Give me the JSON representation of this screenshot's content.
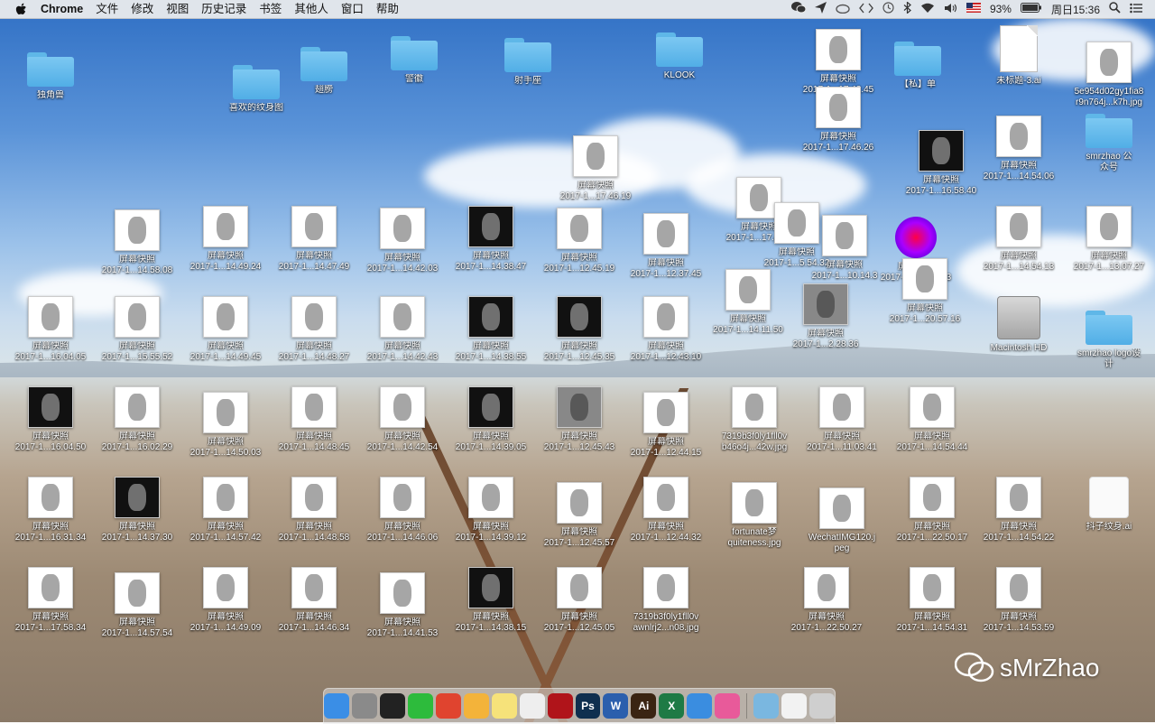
{
  "menubar": {
    "app": "Chrome",
    "menus": [
      "文件",
      "修改",
      "视图",
      "历史记录",
      "书签",
      "其他人",
      "窗口",
      "帮助"
    ],
    "battery": "93%",
    "clock": "周日15:36"
  },
  "desktop_items": [
    {
      "label": "独角兽",
      "kind": "folder"
    },
    {
      "label": "喜欢的纹身图",
      "kind": "folder"
    },
    {
      "label": "翅膀",
      "kind": "folder"
    },
    {
      "label": "警徽",
      "kind": "folder"
    },
    {
      "label": "射手座",
      "kind": "folder"
    },
    {
      "label": "KLOOK",
      "kind": "folder"
    },
    {
      "label": "屏幕快照\n2017-1...17.42.45",
      "kind": "thumb"
    },
    {
      "label": "【私】单",
      "kind": "folder"
    },
    {
      "label": "未标题-3.ai",
      "kind": "doc"
    },
    {
      "label": "5e954d02gy1fia8\nr9n764j...k7h.jpg",
      "kind": "thumb"
    },
    {
      "label": "屏幕快照\n2017-1...17.46.26",
      "kind": "thumb"
    },
    {
      "label": "屏幕快照\n2017-1...17.46.19",
      "kind": "thumb"
    },
    {
      "label": "屏幕快照\n2017-1...16.58.40",
      "kind": "dark"
    },
    {
      "label": "屏幕快照\n2017-1...14.54.06",
      "kind": "thumb"
    },
    {
      "label": "smrzhao 公\n众号",
      "kind": "folder"
    },
    {
      "label": "屏幕快照\n2017-1...14.58.08",
      "kind": "thumb"
    },
    {
      "label": "屏幕快照\n2017-1...14.49.24",
      "kind": "thumb"
    },
    {
      "label": "屏幕快照\n2017-1...14.47.49",
      "kind": "thumb"
    },
    {
      "label": "屏幕快照\n2017-1...14.42.03",
      "kind": "thumb"
    },
    {
      "label": "屏幕快照\n2017-1...14.38.47",
      "kind": "dark"
    },
    {
      "label": "屏幕快照\n2017-1...12.45.19",
      "kind": "thumb"
    },
    {
      "label": "屏幕快照\n2017-1...12.37.45",
      "kind": "thumb"
    },
    {
      "label": "屏幕快照\n2017-1...17.4.53",
      "kind": "thumb"
    },
    {
      "label": "屏幕快照\n2017-1...5.54.32",
      "kind": "thumb"
    },
    {
      "label": "屏幕快照\n2017-1...10.14.3",
      "kind": "thumb"
    },
    {
      "label": "屏幕快照\n2017-1...16.38.03",
      "kind": "burst"
    },
    {
      "label": "屏幕快照\n2017-1...14.54.13",
      "kind": "thumb"
    },
    {
      "label": "屏幕快照\n2017-1...13.07.27",
      "kind": "thumb"
    },
    {
      "label": "屏幕快照\n2017-1...16.04.05",
      "kind": "thumb"
    },
    {
      "label": "屏幕快照\n2017-1...15.55.52",
      "kind": "thumb"
    },
    {
      "label": "屏幕快照\n2017-1...14.49.45",
      "kind": "thumb"
    },
    {
      "label": "屏幕快照\n2017-1...14.48.27",
      "kind": "thumb"
    },
    {
      "label": "屏幕快照\n2017-1...14.42.43",
      "kind": "thumb"
    },
    {
      "label": "屏幕快照\n2017-1...14.38.55",
      "kind": "dark"
    },
    {
      "label": "屏幕快照\n2017-1...12.45.35",
      "kind": "dark"
    },
    {
      "label": "屏幕快照\n2017-1...12.43.10",
      "kind": "thumb"
    },
    {
      "label": "屏幕快照\n2017-1...14.11.50",
      "kind": "thumb"
    },
    {
      "label": "屏幕快照\n2017-1...2.28.36",
      "kind": "mid",
      "selected": true
    },
    {
      "label": "屏幕快照\n2017-1...20.57.16",
      "kind": "thumb"
    },
    {
      "label": "Macintosh HD",
      "kind": "disk"
    },
    {
      "label": "smrzhao logo设\n计",
      "kind": "folder"
    },
    {
      "label": "屏幕快照\n2017-1...16.04.50",
      "kind": "dark"
    },
    {
      "label": "屏幕快照\n2017-1...16.02.29",
      "kind": "thumb"
    },
    {
      "label": "屏幕快照\n2017-1...14.50.03",
      "kind": "thumb"
    },
    {
      "label": "屏幕快照\n2017-1...14.48.45",
      "kind": "thumb"
    },
    {
      "label": "屏幕快照\n2017-1...14.42.54",
      "kind": "thumb"
    },
    {
      "label": "屏幕快照\n2017-1...14.39.05",
      "kind": "dark"
    },
    {
      "label": "屏幕快照\n2017-1...12.45.43",
      "kind": "mid"
    },
    {
      "label": "屏幕快照\n2017-1...12.44.15",
      "kind": "thumb"
    },
    {
      "label": "7319b3f0ly1fll0v\nb46o4j...42w.jpg",
      "kind": "thumb"
    },
    {
      "label": "屏幕快照\n2017-1...11.03.41",
      "kind": "thumb"
    },
    {
      "label": "屏幕快照\n2017-1...14.54.44",
      "kind": "thumb"
    },
    {
      "label": "屏幕快照\n2017-1...16.31.34",
      "kind": "thumb"
    },
    {
      "label": "屏幕快照\n2017-1...14.37.30",
      "kind": "dark"
    },
    {
      "label": "屏幕快照\n2017-1...14.57.42",
      "kind": "thumb"
    },
    {
      "label": "屏幕快照\n2017-1...14.48.58",
      "kind": "thumb"
    },
    {
      "label": "屏幕快照\n2017-1...14.46.06",
      "kind": "thumb"
    },
    {
      "label": "屏幕快照\n2017-1...14.39.12",
      "kind": "thumb"
    },
    {
      "label": "屏幕快照\n2017-1...12.45.57",
      "kind": "thumb"
    },
    {
      "label": "屏幕快照\n2017-1...12.44.32",
      "kind": "thumb"
    },
    {
      "label": "fortunate梦\nquiteness.jpg",
      "kind": "thumb"
    },
    {
      "label": "WechatIMG120.j\npeg",
      "kind": "thumb"
    },
    {
      "label": "屏幕快照\n2017-1...22.50.17",
      "kind": "thumb"
    },
    {
      "label": "屏幕快照\n2017-1...14.54.22",
      "kind": "thumb"
    },
    {
      "label": "抖子纹身.ai",
      "kind": "dots"
    },
    {
      "label": "屏幕快照\n2017-1...17.58.34",
      "kind": "thumb"
    },
    {
      "label": "屏幕快照\n2017-1...14.57.54",
      "kind": "thumb"
    },
    {
      "label": "屏幕快照\n2017-1...14.49.09",
      "kind": "thumb"
    },
    {
      "label": "屏幕快照\n2017-1...14.46.34",
      "kind": "thumb"
    },
    {
      "label": "屏幕快照\n2017-1...14.41.53",
      "kind": "thumb"
    },
    {
      "label": "屏幕快照\n2017-1...14.38.15",
      "kind": "dark"
    },
    {
      "label": "屏幕快照\n2017-1...12.45.05",
      "kind": "thumb"
    },
    {
      "label": "7319b3f0ly1fll0v\nawnlrj2...n08.jpg",
      "kind": "thumb"
    },
    {
      "label": "屏幕快照\n2017-1...22.50.27",
      "kind": "thumb"
    },
    {
      "label": "屏幕快照\n2017-1...14.54.31",
      "kind": "thumb"
    },
    {
      "label": "屏幕快照\n2017-1...14.53.59",
      "kind": "thumb"
    }
  ],
  "dock": {
    "apps": [
      {
        "name": "finder",
        "short": "",
        "color": "#3a8ee6"
      },
      {
        "name": "launchpad",
        "short": "",
        "color": "#8a8a8a"
      },
      {
        "name": "qq",
        "short": "",
        "color": "#222"
      },
      {
        "name": "wechat",
        "short": "",
        "color": "#2dbb3c"
      },
      {
        "name": "chrome",
        "short": "",
        "color": "#e0442f"
      },
      {
        "name": "photos",
        "short": "",
        "color": "#f3b33a"
      },
      {
        "name": "notes",
        "short": "",
        "color": "#f6e27a"
      },
      {
        "name": "reminders",
        "short": "",
        "color": "#eeeeee"
      },
      {
        "name": "acrobat",
        "short": "",
        "color": "#b0141a"
      },
      {
        "name": "photoshop",
        "short": "Ps",
        "color": "#0f2f4f"
      },
      {
        "name": "word",
        "short": "W",
        "color": "#2b5fad"
      },
      {
        "name": "illustrator",
        "short": "Ai",
        "color": "#3a2412"
      },
      {
        "name": "excel",
        "short": "X",
        "color": "#1e7a45"
      },
      {
        "name": "safari",
        "short": "",
        "color": "#3a8de0"
      },
      {
        "name": "itunes",
        "short": "",
        "color": "#e85a9a"
      },
      {
        "name": "downloads",
        "short": "",
        "color": "#7ab7e0"
      },
      {
        "name": "mail",
        "short": "",
        "color": "#f2f2f2"
      },
      {
        "name": "trash",
        "short": "",
        "color": "#cfcfcf"
      }
    ]
  },
  "watermark": {
    "text": "sMrZhao"
  }
}
